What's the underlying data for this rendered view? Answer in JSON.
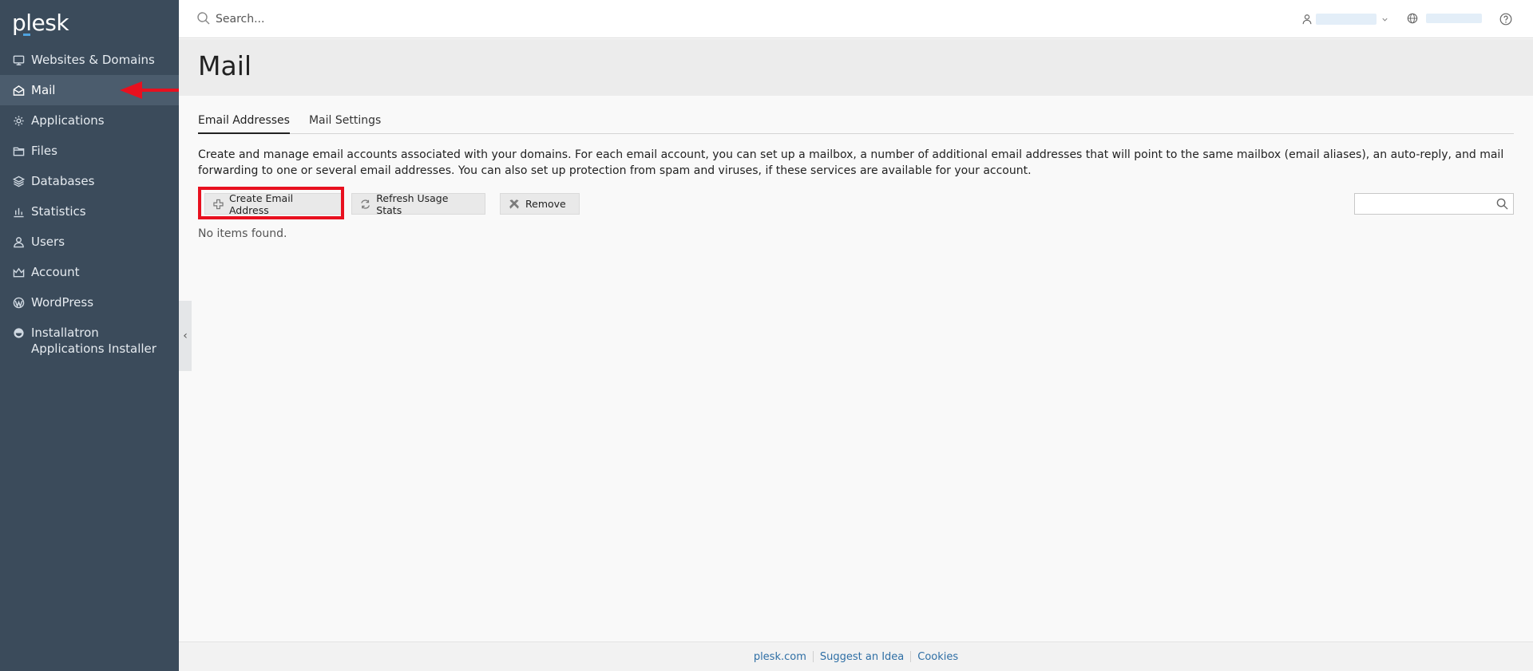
{
  "brand": {
    "logo_text": "plesk"
  },
  "sidebar": {
    "items": [
      {
        "label": "Websites & Domains",
        "icon": "monitor-icon",
        "active": false
      },
      {
        "label": "Mail",
        "icon": "envelope-icon",
        "active": true
      },
      {
        "label": "Applications",
        "icon": "gear-icon",
        "active": false
      },
      {
        "label": "Files",
        "icon": "folder-icon",
        "active": false
      },
      {
        "label": "Databases",
        "icon": "layers-icon",
        "active": false
      },
      {
        "label": "Statistics",
        "icon": "bar-chart-icon",
        "active": false
      },
      {
        "label": "Users",
        "icon": "user-icon",
        "active": false
      },
      {
        "label": "Account",
        "icon": "crown-icon",
        "active": false
      },
      {
        "label": "WordPress",
        "icon": "wordpress-icon",
        "active": false
      },
      {
        "label": "Installatron Applications Installer",
        "icon": "installatron-icon",
        "active": false
      }
    ],
    "collapse_glyph": "‹"
  },
  "topbar": {
    "search_placeholder": "Search..."
  },
  "page": {
    "title": "Mail",
    "tabs": [
      {
        "label": "Email Addresses",
        "active": true
      },
      {
        "label": "Mail Settings",
        "active": false
      }
    ],
    "description": "Create and manage email accounts associated with your domains. For each email account, you can set up a mailbox, a number of additional email addresses that will point to the same mailbox (email aliases), an auto-reply, and mail forwarding to one or several email addresses. You can also set up protection from spam and viruses, if these services are available for your account.",
    "toolbar": {
      "create_label": "Create Email Address",
      "refresh_label": "Refresh Usage Stats",
      "remove_label": "Remove"
    },
    "empty_text": "No items found."
  },
  "footer": {
    "links": [
      "plesk.com",
      "Suggest an Idea",
      "Cookies"
    ]
  },
  "colors": {
    "sidebar_bg": "#3b4b5b",
    "sidebar_active": "#4b5c6d",
    "annotation_red": "#e8101f",
    "link_blue": "#2f6fa5"
  }
}
